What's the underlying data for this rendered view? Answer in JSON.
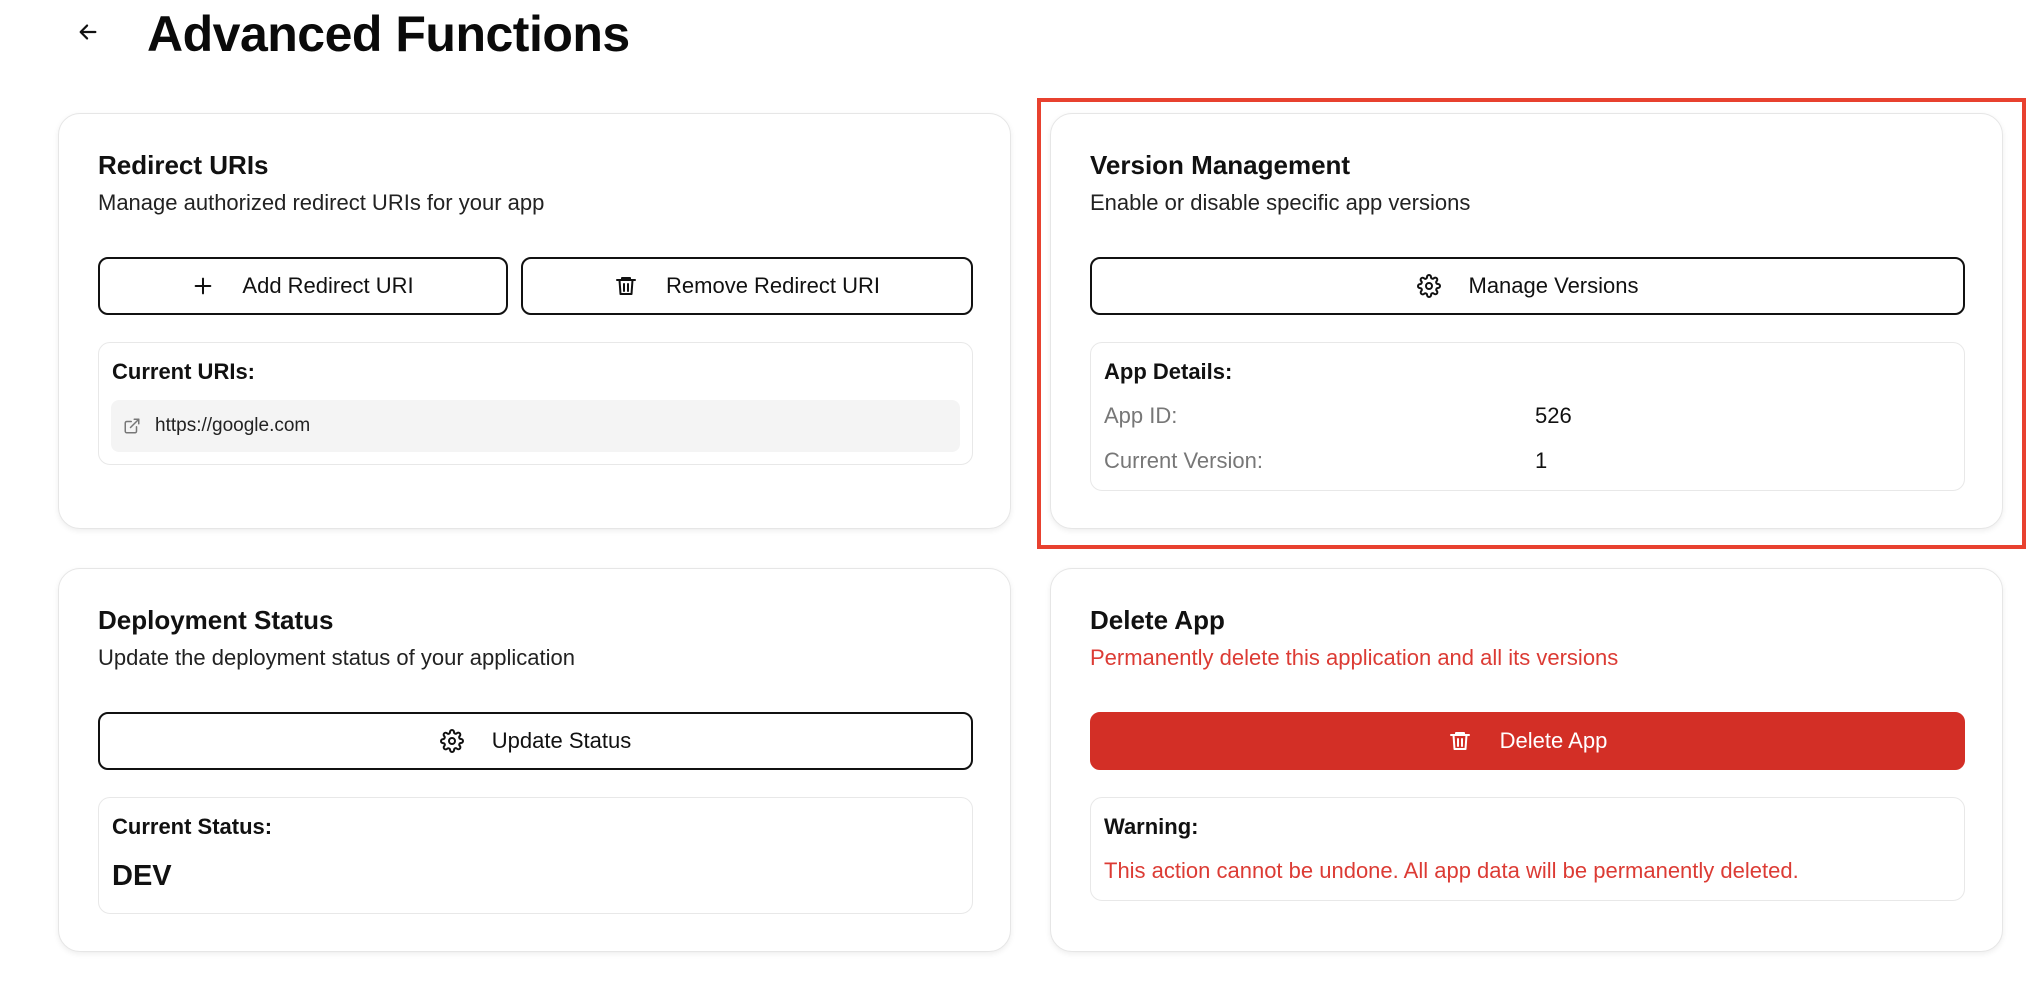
{
  "header": {
    "back_icon": "arrow-left-icon",
    "title": "Advanced Functions"
  },
  "redirect_uris": {
    "title": "Redirect URIs",
    "subtitle": "Manage authorized redirect URIs for your app",
    "add_button": {
      "icon": "plus-icon",
      "label": "Add Redirect URI"
    },
    "remove_button": {
      "icon": "trash-icon",
      "label": "Remove Redirect URI"
    },
    "current_label": "Current URIs:",
    "uris": [
      {
        "icon": "external-link-icon",
        "value": "https://google.com"
      }
    ]
  },
  "version_management": {
    "title": "Version Management",
    "subtitle": "Enable or disable specific app versions",
    "manage_button": {
      "icon": "gear-icon",
      "label": "Manage Versions"
    },
    "details_label": "App Details:",
    "app_id_label": "App ID:",
    "app_id_value": "526",
    "current_version_label": "Current Version:",
    "current_version_value": "1"
  },
  "deployment_status": {
    "title": "Deployment Status",
    "subtitle": "Update the deployment status of your application",
    "update_button": {
      "icon": "gear-icon",
      "label": "Update Status"
    },
    "current_label": "Current Status:",
    "current_value": "DEV"
  },
  "delete_app": {
    "title": "Delete App",
    "subtitle": "Permanently delete this application and all its versions",
    "delete_button": {
      "icon": "trash-icon",
      "label": "Delete App"
    },
    "warning_label": "Warning:",
    "warning_text": "This action cannot be undone. All app data will be permanently deleted."
  },
  "colors": {
    "danger": "#d32f26",
    "danger_text": "#dc3b34",
    "highlight": "#e8412f"
  }
}
